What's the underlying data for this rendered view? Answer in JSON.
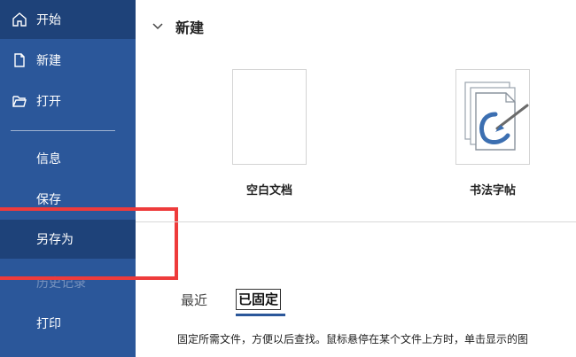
{
  "sidebar": {
    "items": [
      {
        "label": "开始",
        "icon": "home-icon"
      },
      {
        "label": "新建",
        "icon": "new-document-icon"
      },
      {
        "label": "打开",
        "icon": "folder-open-icon"
      },
      {
        "label": "信息"
      },
      {
        "label": "保存"
      },
      {
        "label": "另存为"
      },
      {
        "label": "历史记录"
      },
      {
        "label": "打印"
      }
    ],
    "active_item": "另存为"
  },
  "new_section": {
    "title": "新建",
    "templates": [
      {
        "label": "空白文档"
      },
      {
        "label": "书法字帖"
      }
    ]
  },
  "files": {
    "tabs": [
      {
        "label": "最近"
      },
      {
        "label": "已固定"
      }
    ],
    "selected_tab": "已固定",
    "description": "固定所需文件，方便以后查找。鼠标悬停在某个文件上方时，单击显示的图"
  },
  "colors": {
    "sidebar_bg": "#2b579a",
    "sidebar_active": "#1e4279",
    "annotation_red": "#ee3b3b"
  }
}
